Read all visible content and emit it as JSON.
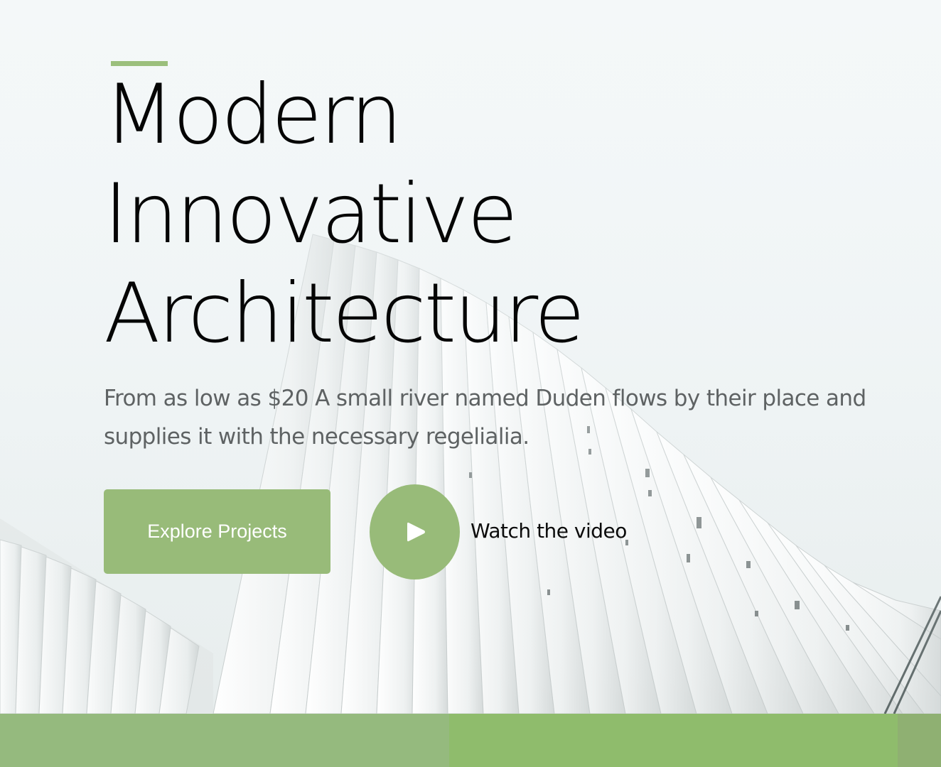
{
  "hero": {
    "headline": {
      "line1": "Modern",
      "line2": "Innovative",
      "line3": "Architecture"
    },
    "subtitle": "From as low as $20 A small river named Duden flows by their place and supplies it with the necessary regelialia.",
    "explore_button_label": "Explore Projects",
    "watch_video_label": "Watch the video"
  },
  "icons": {
    "play": "play-icon"
  },
  "colors": {
    "accent": "#98bb79",
    "headline": "#050505",
    "subtitle": "#5e6263",
    "button_text": "#ffffff",
    "strip": [
      "#95ba7e",
      "#8fbc6c",
      "#8fb072"
    ]
  }
}
